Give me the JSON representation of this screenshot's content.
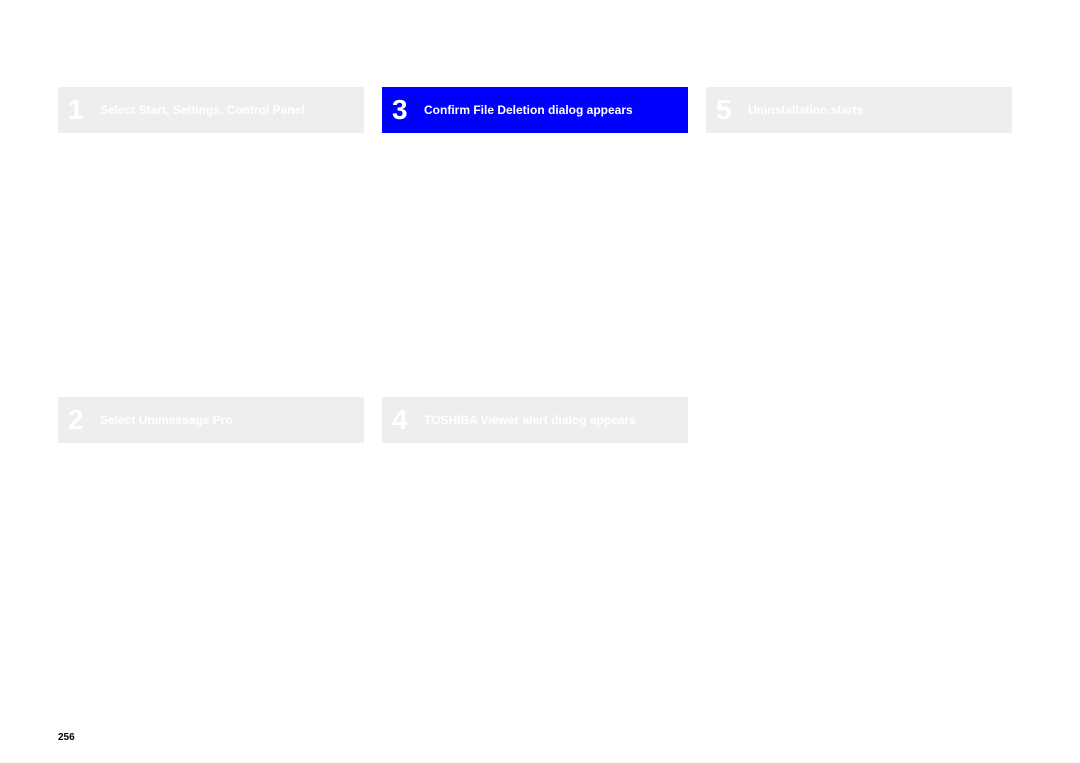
{
  "page_number": "256",
  "steps": [
    {
      "number": "1",
      "title": "Select Start, Settings, Control Panel",
      "highlighted": false
    },
    {
      "number": "2",
      "title": "Select Unimessage Pro",
      "highlighted": false
    },
    {
      "number": "3",
      "title": "Confirm File Deletion dialog appears",
      "highlighted": true
    },
    {
      "number": "4",
      "title": "TOSHIBA Viewer alert dialog appears",
      "highlighted": false
    },
    {
      "number": "5",
      "title": "Uninstallation starts",
      "highlighted": false
    }
  ]
}
